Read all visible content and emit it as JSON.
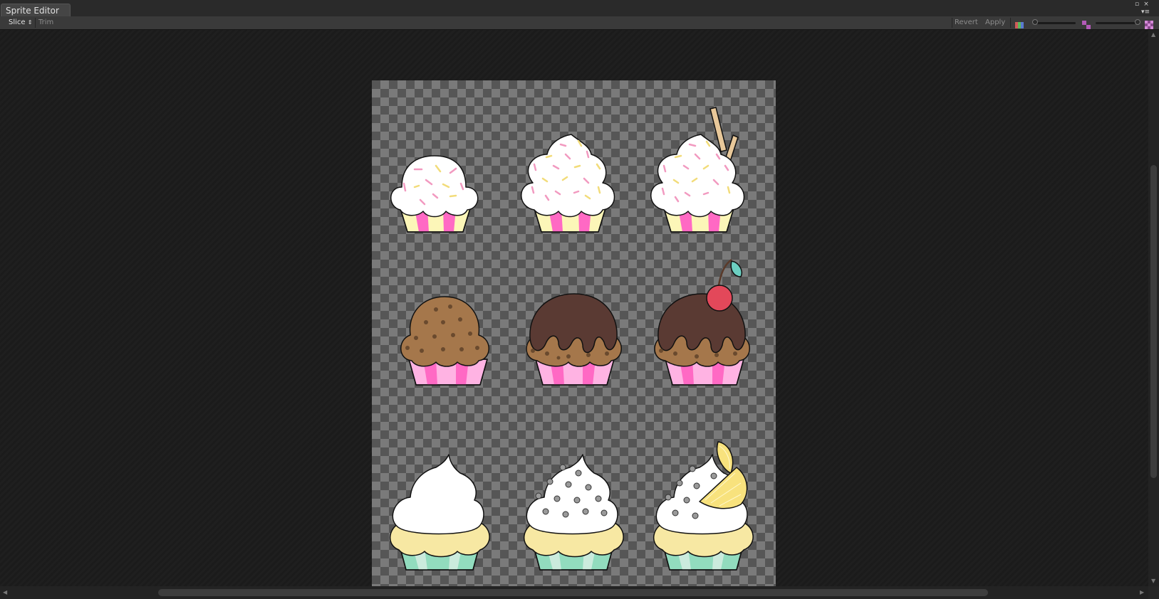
{
  "window": {
    "tab_title": "Sprite Editor",
    "controls": [
      "▫",
      "×",
      "▾≡"
    ]
  },
  "toolbar": {
    "slice_label": "Slice",
    "slice_arrow": "⇕",
    "trim_label": "Trim",
    "revert_label": "Revert",
    "apply_label": "Apply",
    "icons": [
      "rgb-channel-icon",
      "mip-level-icon",
      "alpha-checker-icon"
    ],
    "zoom_level": 1.0,
    "mip_level": 0.0
  },
  "sprite_sheet": {
    "grid": [
      3,
      3
    ],
    "colors": {
      "outline": "#111111",
      "frosting_white": "#ffffff",
      "sprinkle_pink": "#f29ac0",
      "sprinkle_yellow": "#f2dc7a",
      "liner_pink": "#ff69c4",
      "liner_cream": "#fcf6b8",
      "liner_lightpink": "#ffb3e3",
      "liner_mint": "#92dcbe",
      "liner_lightmint": "#cbebdd",
      "cake_brown": "#a5774b",
      "chocolate": "#5a3a33",
      "cake_yellow": "#f7e8a3",
      "cherry": "#e3485a",
      "leaf": "#6ccfc1",
      "lemon": "#f8e27d",
      "wafer": "#e8c89a",
      "dot_gray": "#9a9a9a"
    },
    "sprites": [
      {
        "name": "sprinkle-vanilla",
        "frosting": "white",
        "liner": "pink",
        "topping": "sprinkles"
      },
      {
        "name": "sprinkle-swirl",
        "frosting": "white",
        "liner": "pink",
        "topping": "sprinkles"
      },
      {
        "name": "sprinkle-swirl-wafer",
        "frosting": "white",
        "liner": "pink",
        "topping": "wafers"
      },
      {
        "name": "chocolate-chip",
        "frosting": "brown",
        "liner": "lightpink",
        "topping": "chips"
      },
      {
        "name": "chocolate-drizzle",
        "frosting": "chocolate",
        "liner": "pink",
        "topping": "chips"
      },
      {
        "name": "chocolate-cherry",
        "frosting": "chocolate",
        "liner": "lightpink",
        "topping": "cherry"
      },
      {
        "name": "cream-plain",
        "frosting": "white",
        "liner": "mint",
        "topping": "none"
      },
      {
        "name": "cream-dots",
        "frosting": "white",
        "liner": "mint",
        "topping": "dots"
      },
      {
        "name": "cream-lemon",
        "frosting": "white",
        "liner": "mint",
        "topping": "lemon"
      }
    ]
  }
}
